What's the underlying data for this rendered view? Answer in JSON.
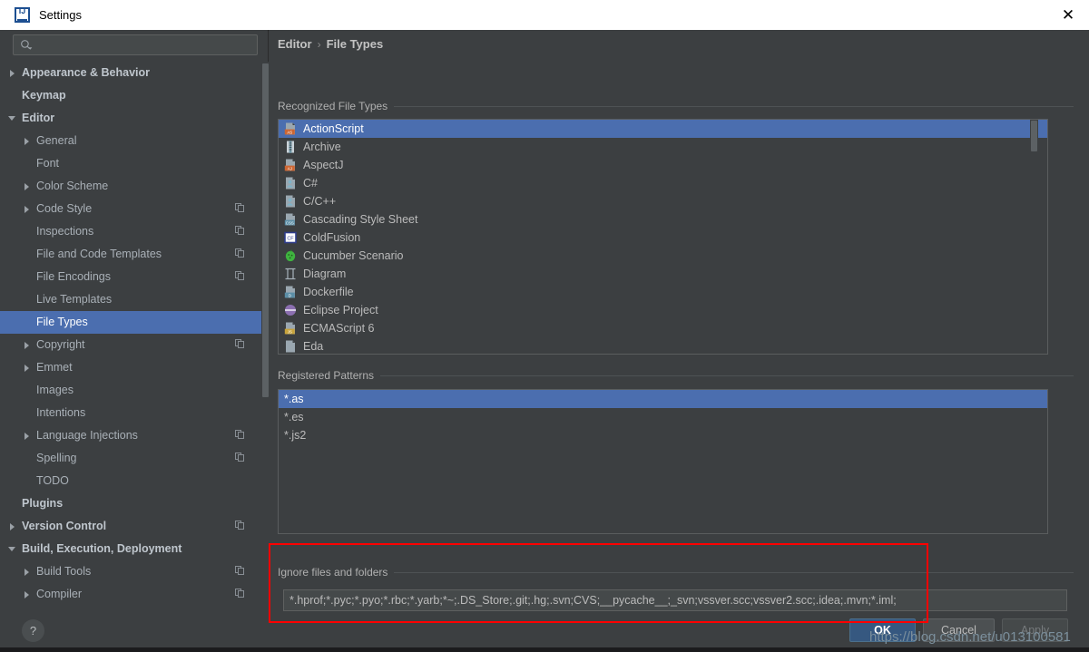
{
  "window": {
    "title": "Settings",
    "app_icon": "intellij-idea-icon",
    "close_label": "✕"
  },
  "sidebar": {
    "search": {
      "value": "",
      "placeholder": "",
      "icon": "search-icon"
    },
    "items": [
      {
        "label": "Appearance & Behavior",
        "indent": 0,
        "arrow": "right",
        "bold": true,
        "badge": false,
        "selected": false
      },
      {
        "label": "Keymap",
        "indent": 0,
        "arrow": "none",
        "bold": true,
        "badge": false,
        "selected": false
      },
      {
        "label": "Editor",
        "indent": 0,
        "arrow": "down",
        "bold": true,
        "badge": false,
        "selected": false
      },
      {
        "label": "General",
        "indent": 1,
        "arrow": "right",
        "bold": false,
        "badge": false,
        "selected": false
      },
      {
        "label": "Font",
        "indent": 1,
        "arrow": "none",
        "bold": false,
        "badge": false,
        "selected": false
      },
      {
        "label": "Color Scheme",
        "indent": 1,
        "arrow": "right",
        "bold": false,
        "badge": false,
        "selected": false
      },
      {
        "label": "Code Style",
        "indent": 1,
        "arrow": "right",
        "bold": false,
        "badge": true,
        "selected": false
      },
      {
        "label": "Inspections",
        "indent": 1,
        "arrow": "none",
        "bold": false,
        "badge": true,
        "selected": false
      },
      {
        "label": "File and Code Templates",
        "indent": 1,
        "arrow": "none",
        "bold": false,
        "badge": true,
        "selected": false
      },
      {
        "label": "File Encodings",
        "indent": 1,
        "arrow": "none",
        "bold": false,
        "badge": true,
        "selected": false
      },
      {
        "label": "Live Templates",
        "indent": 1,
        "arrow": "none",
        "bold": false,
        "badge": false,
        "selected": false
      },
      {
        "label": "File Types",
        "indent": 1,
        "arrow": "none",
        "bold": false,
        "badge": false,
        "selected": true
      },
      {
        "label": "Copyright",
        "indent": 1,
        "arrow": "right",
        "bold": false,
        "badge": true,
        "selected": false
      },
      {
        "label": "Emmet",
        "indent": 1,
        "arrow": "right",
        "bold": false,
        "badge": false,
        "selected": false
      },
      {
        "label": "Images",
        "indent": 1,
        "arrow": "none",
        "bold": false,
        "badge": false,
        "selected": false
      },
      {
        "label": "Intentions",
        "indent": 1,
        "arrow": "none",
        "bold": false,
        "badge": false,
        "selected": false
      },
      {
        "label": "Language Injections",
        "indent": 1,
        "arrow": "right",
        "bold": false,
        "badge": true,
        "selected": false
      },
      {
        "label": "Spelling",
        "indent": 1,
        "arrow": "none",
        "bold": false,
        "badge": true,
        "selected": false
      },
      {
        "label": "TODO",
        "indent": 1,
        "arrow": "none",
        "bold": false,
        "badge": false,
        "selected": false
      },
      {
        "label": "Plugins",
        "indent": 0,
        "arrow": "none",
        "bold": true,
        "badge": false,
        "selected": false
      },
      {
        "label": "Version Control",
        "indent": 0,
        "arrow": "right",
        "bold": true,
        "badge": true,
        "selected": false
      },
      {
        "label": "Build, Execution, Deployment",
        "indent": 0,
        "arrow": "down",
        "bold": true,
        "badge": false,
        "selected": false
      },
      {
        "label": "Build Tools",
        "indent": 1,
        "arrow": "right",
        "bold": false,
        "badge": true,
        "selected": false
      },
      {
        "label": "Compiler",
        "indent": 1,
        "arrow": "right",
        "bold": false,
        "badge": true,
        "selected": false
      }
    ]
  },
  "main": {
    "breadcrumb": {
      "parent": "Editor",
      "separator": "›",
      "current": "File Types"
    },
    "recognized": {
      "label": "Recognized File Types",
      "items": [
        {
          "label": "ActionScript",
          "icon": "actionscript-file-icon",
          "tag": "AS",
          "tag_color": "#cc6633",
          "icon_color": "#9aa7b0",
          "selected": true
        },
        {
          "label": "Archive",
          "icon": "archive-file-icon",
          "tag": "",
          "tag_color": "",
          "icon_color": "#7fb3c8",
          "selected": false
        },
        {
          "label": "AspectJ",
          "icon": "aspectj-file-icon",
          "tag": "AJ",
          "tag_color": "#cc6633",
          "icon_color": "#9aa7b0",
          "selected": false
        },
        {
          "label": "C#",
          "icon": "csharp-file-icon",
          "tag": "",
          "tag_color": "",
          "icon_color": "#9aa7b0",
          "selected": false
        },
        {
          "label": "C/C++",
          "icon": "cpp-file-icon",
          "tag": "",
          "tag_color": "",
          "icon_color": "#9aa7b0",
          "selected": false
        },
        {
          "label": "Cascading Style Sheet",
          "icon": "css-file-icon",
          "tag": "CSS",
          "tag_color": "#5b8ea6",
          "icon_color": "#9aa7b0",
          "selected": false
        },
        {
          "label": "ColdFusion",
          "icon": "coldfusion-file-icon",
          "tag": "CF",
          "tag_color": "#2f3d8c",
          "icon_color": "#2f3d8c",
          "selected": false
        },
        {
          "label": "Cucumber Scenario",
          "icon": "cucumber-file-icon",
          "tag": "",
          "tag_color": "",
          "icon_color": "#3fb43f",
          "selected": false
        },
        {
          "label": "Diagram",
          "icon": "diagram-file-icon",
          "tag": "",
          "tag_color": "",
          "icon_color": "#9aa7b0",
          "selected": false
        },
        {
          "label": "Dockerfile",
          "icon": "docker-file-icon",
          "tag": "D",
          "tag_color": "#5b8ea6",
          "icon_color": "#9aa7b0",
          "selected": false
        },
        {
          "label": "Eclipse Project",
          "icon": "eclipse-file-icon",
          "tag": "",
          "tag_color": "",
          "icon_color": "#8b6fb0",
          "selected": false
        },
        {
          "label": "ECMAScript 6",
          "icon": "ecmascript-file-icon",
          "tag": "JS",
          "tag_color": "#c8a43c",
          "icon_color": "#9aa7b0",
          "selected": false
        },
        {
          "label": "Eda",
          "icon": "generic-file-icon",
          "tag": "",
          "tag_color": "",
          "icon_color": "#9aa7b0",
          "selected": false
        }
      ],
      "buttons": [
        {
          "name": "add-file-type-button",
          "glyph": "+"
        },
        {
          "name": "remove-file-type-button",
          "glyph": "−"
        },
        {
          "name": "edit-file-type-button",
          "glyph": "✎"
        }
      ]
    },
    "patterns": {
      "label": "Registered Patterns",
      "items": [
        {
          "label": "*.as",
          "selected": true
        },
        {
          "label": "*.es",
          "selected": false
        },
        {
          "label": "*.js2",
          "selected": false
        }
      ],
      "buttons": [
        {
          "name": "add-pattern-button",
          "glyph": "+"
        },
        {
          "name": "remove-pattern-button",
          "glyph": "−"
        },
        {
          "name": "edit-pattern-button",
          "glyph": "✎"
        }
      ]
    },
    "ignore": {
      "label": "Ignore files and folders",
      "value": "*.hprof;*.pyc;*.pyo;*.rbc;*.yarb;*~;.DS_Store;.git;.hg;.svn;CVS;__pycache__;_svn;vssver.scc;vssver2.scc;.idea;.mvn;*.iml;",
      "placeholder": "",
      "highlight_color": "#ff0000"
    }
  },
  "footer": {
    "help_label": "?",
    "ok_label": "OK",
    "cancel_label": "Cancel",
    "apply_label": "Apply"
  },
  "watermark": {
    "text": "https://blog.csdn.net/u013100581"
  },
  "colors": {
    "accent_selection": "#4b6eaf",
    "dialog_bg": "#3c3f41",
    "field_bg": "#45494a",
    "ok_button": "#365880",
    "highlight_red": "#ff0000"
  }
}
